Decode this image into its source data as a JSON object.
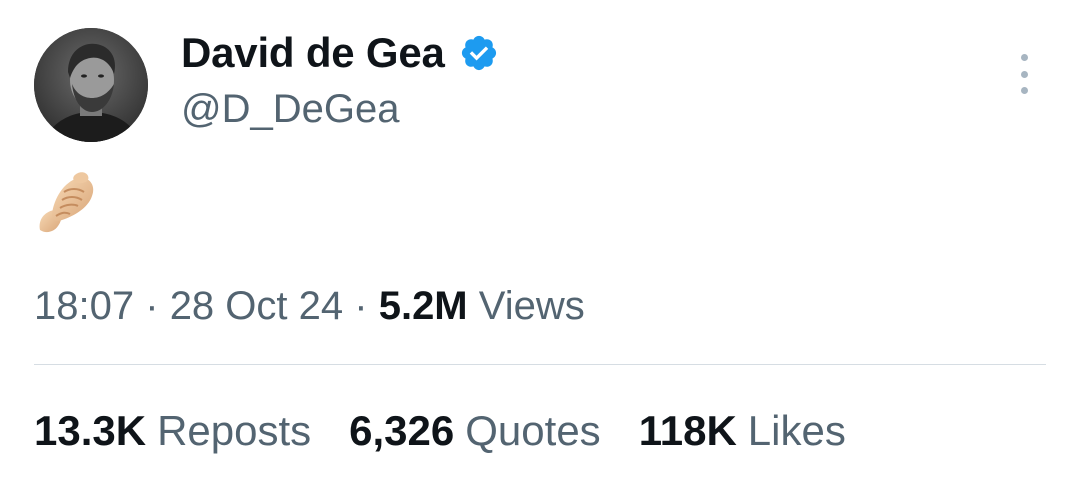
{
  "author": {
    "display_name": "David de Gea",
    "handle": "@D_DeGea",
    "verified": true,
    "verified_color": "#1d9bf0",
    "avatar_icon": "profile-photo"
  },
  "more_menu": {
    "icon": "more-vertical-icon"
  },
  "tweet": {
    "content_emoji": "🤌",
    "content_icon": "pinched-fingers-emoji"
  },
  "meta": {
    "time": "18:07",
    "separator": "·",
    "date": "28 Oct 24",
    "views_count": "5.2M",
    "views_label": "Views"
  },
  "stats": [
    {
      "count": "13.3K",
      "label": "Reposts"
    },
    {
      "count": "6,326",
      "label": "Quotes"
    },
    {
      "count": "118K",
      "label": "Likes"
    }
  ],
  "colors": {
    "text_primary": "#0f1419",
    "text_secondary": "#536471",
    "divider": "#d6dde3",
    "accent": "#1d9bf0"
  }
}
